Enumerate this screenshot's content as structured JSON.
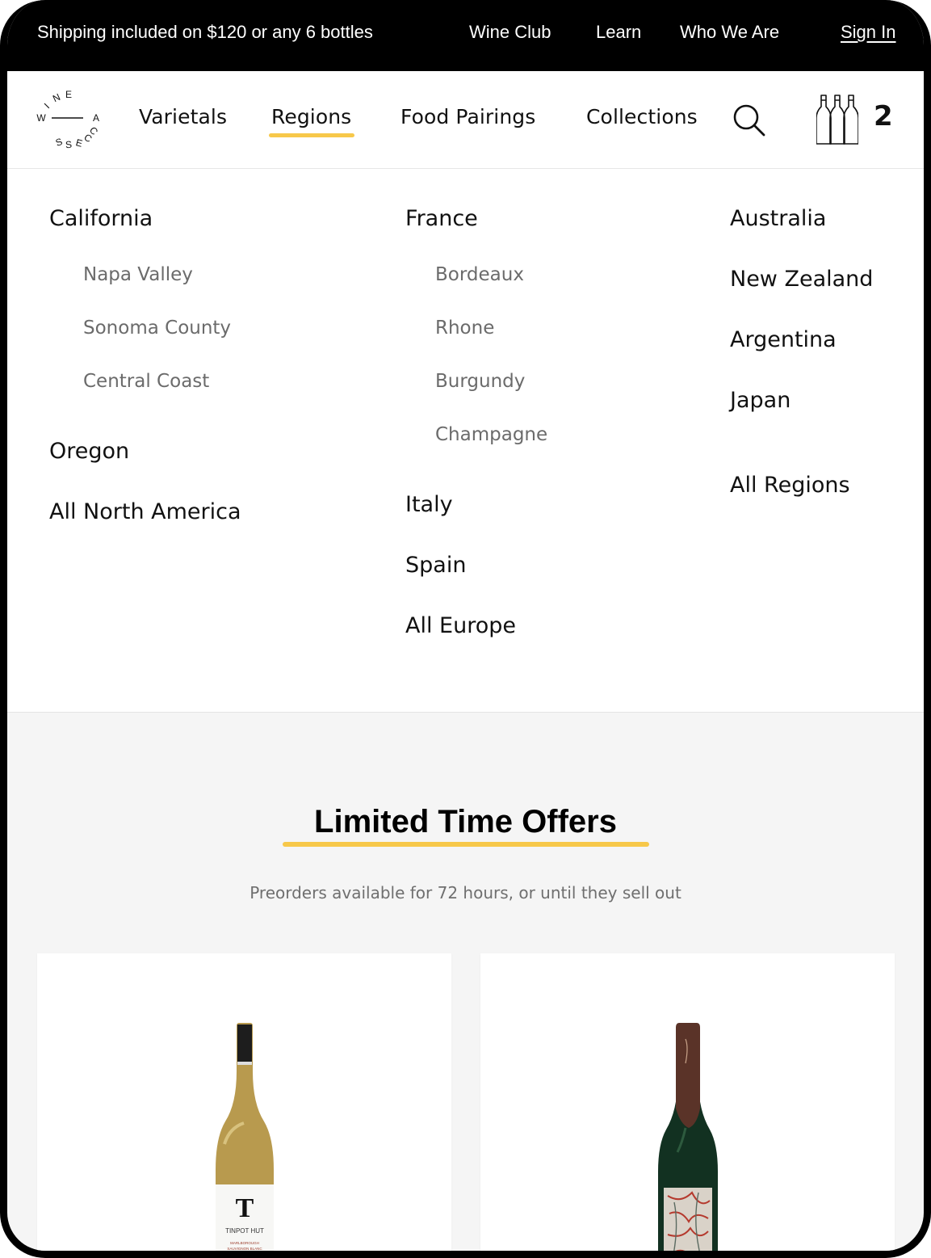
{
  "topbar": {
    "promo": "Shipping included on $120 or any 6 bottles",
    "links": [
      "Wine Club",
      "Learn",
      "Who We Are"
    ],
    "sign_in": "Sign In"
  },
  "logo": {
    "letters_top": [
      "W",
      "I",
      "N",
      "E"
    ],
    "letter_right": "A",
    "letters_bottom": [
      "C",
      "C",
      "E",
      "S",
      "S"
    ]
  },
  "nav": {
    "items": [
      "Varietals",
      "Regions",
      "Food Pairings",
      "Collections"
    ],
    "active": "Regions",
    "cart_count": "2",
    "icons": [
      "search-icon",
      "wine-bottles-icon"
    ]
  },
  "regions_menu": {
    "col1": {
      "california": "California",
      "california_subs": [
        "Napa Valley",
        "Sonoma County",
        "Central Coast"
      ],
      "oregon": "Oregon",
      "all": "All North America"
    },
    "col2": {
      "france": "France",
      "france_subs": [
        "Bordeaux",
        "Rhone",
        "Burgundy",
        "Champagne"
      ],
      "italy": "Italy",
      "spain": "Spain",
      "all": "All Europe"
    },
    "col3": {
      "items": [
        "Australia",
        "New Zealand",
        "Argentina",
        "Japan"
      ],
      "all": "All Regions"
    }
  },
  "offers": {
    "title": "Limited Time Offers",
    "subtitle": "Preorders available for 72 hours, or until they sell out",
    "products": [
      {
        "label_brand": "T",
        "label_name": "TINPOT HUT",
        "label_region": "MARLBOROUGH",
        "label_varietal": "SAUVIGNON BLANC"
      },
      {
        "type": "sparkling"
      }
    ]
  },
  "colors": {
    "accent": "#f7c84a",
    "topbar_bg": "#000000",
    "section_bg": "#f5f5f5",
    "sub_text": "#6b6b6b"
  }
}
